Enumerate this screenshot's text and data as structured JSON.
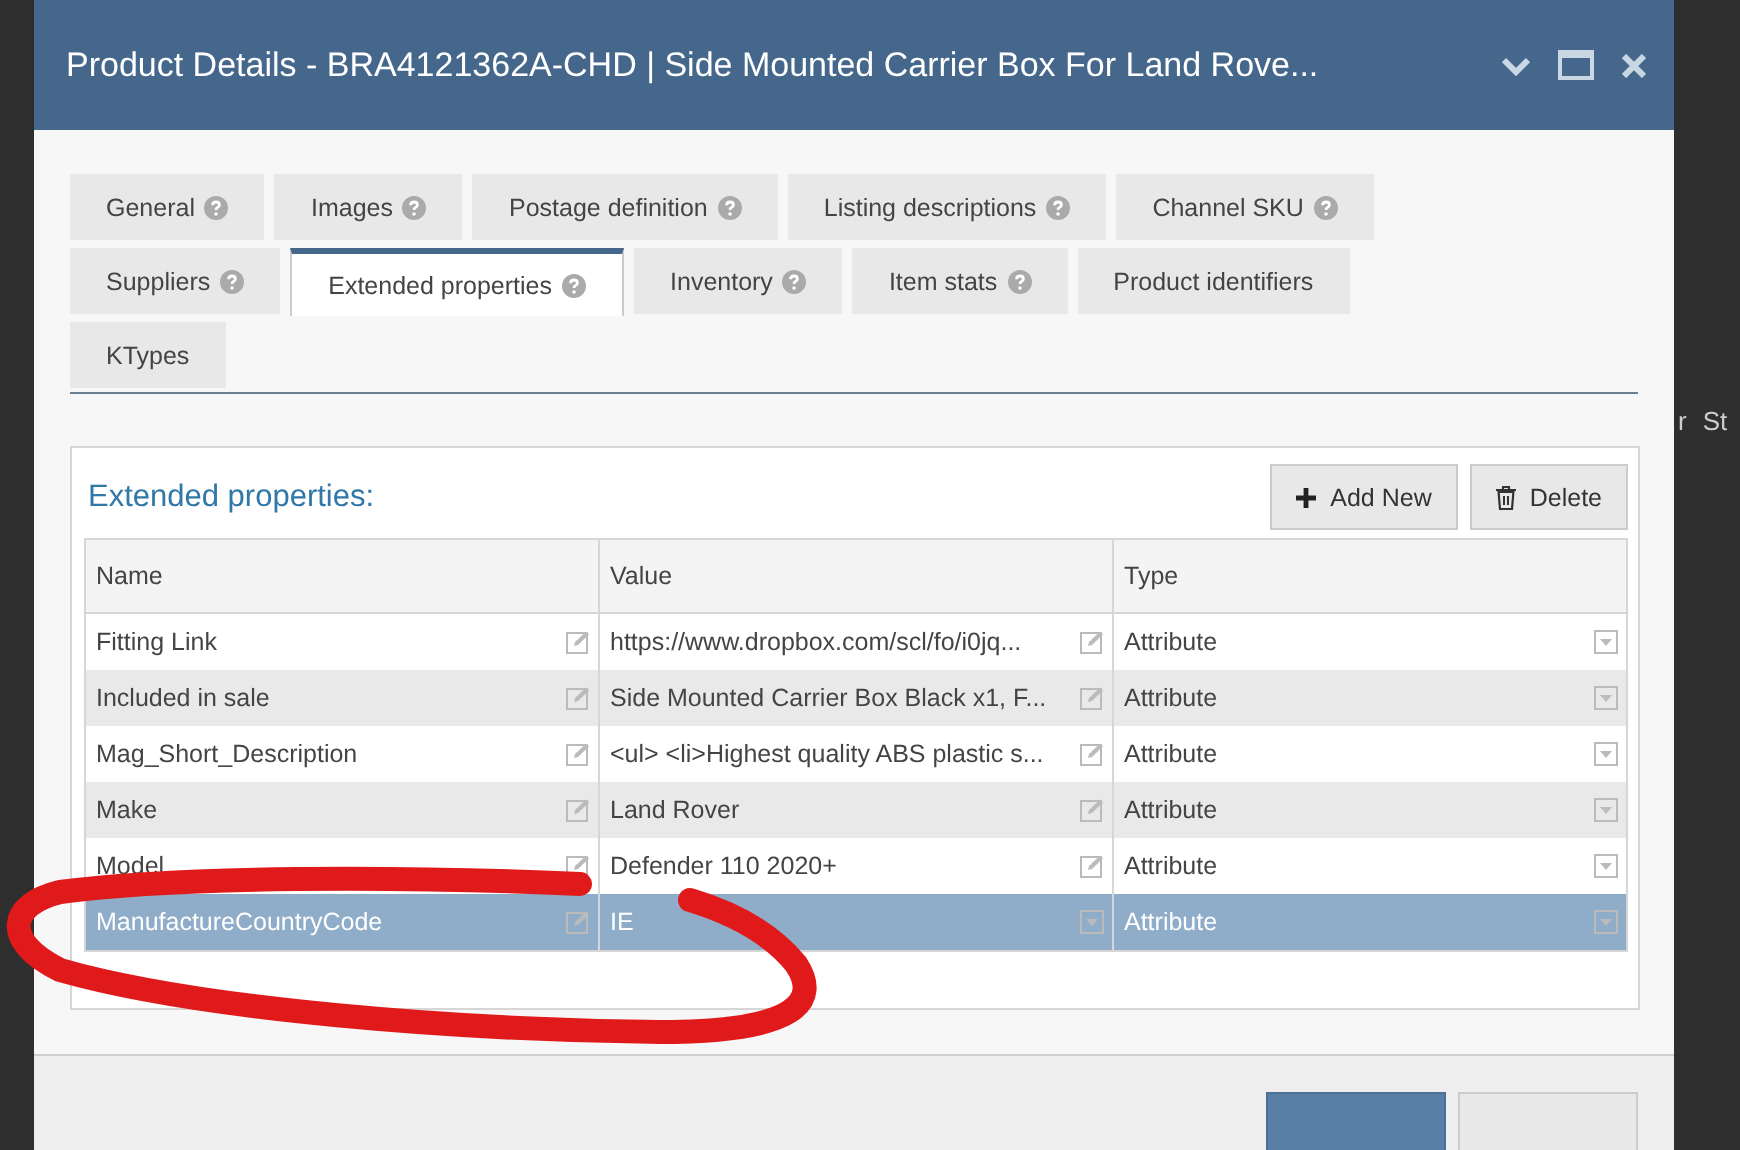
{
  "background_table": {
    "columns": [
      "r",
      "St"
    ]
  },
  "window": {
    "title": "Product Details - BRA4121362A-CHD | Side Mounted Carrier Box For Land Rove..."
  },
  "tab_rows": [
    [
      {
        "label": "General",
        "help": true,
        "selected": false
      },
      {
        "label": "Images",
        "help": true,
        "selected": false
      },
      {
        "label": "Postage definition",
        "help": true,
        "selected": false
      },
      {
        "label": "Listing descriptions",
        "help": true,
        "selected": false
      },
      {
        "label": "Channel SKU",
        "help": true,
        "selected": false
      }
    ],
    [
      {
        "label": "Suppliers",
        "help": true,
        "selected": false
      },
      {
        "label": "Extended properties",
        "help": true,
        "selected": true
      },
      {
        "label": "Inventory",
        "help": true,
        "selected": false
      },
      {
        "label": "Item stats",
        "help": true,
        "selected": false
      },
      {
        "label": "Product identifiers",
        "help": false,
        "selected": false
      }
    ],
    [
      {
        "label": "KTypes",
        "help": false,
        "selected": false
      }
    ]
  ],
  "panel": {
    "title": "Extended properties:",
    "buttons": [
      {
        "label": "Add New",
        "kind": "add"
      },
      {
        "label": "Delete",
        "kind": "delete"
      }
    ],
    "table": {
      "columns": [
        "Name",
        "Value",
        "Type"
      ],
      "rows": [
        {
          "name": "Fitting Link",
          "value": "https://www.dropbox.com/scl/fo/i0jq...",
          "type": "Attribute",
          "selected": false
        },
        {
          "name": "Included in sale",
          "value": "Side Mounted Carrier Box Black x1, F...",
          "type": "Attribute",
          "selected": false
        },
        {
          "name": "Mag_Short_Description",
          "value": "<ul> <li>Highest quality ABS plastic s...",
          "type": "Attribute",
          "selected": false
        },
        {
          "name": "Make",
          "value": "Land Rover",
          "type": "Attribute",
          "selected": false
        },
        {
          "name": "Model",
          "value": "Defender 110 2020+",
          "type": "Attribute",
          "selected": false
        },
        {
          "name": "ManufactureCountryCode",
          "value": "IE",
          "type": "Attribute",
          "selected": true
        }
      ]
    }
  },
  "footer": {
    "buttons": [
      {
        "kind": "primary"
      },
      {
        "kind": "secondary"
      }
    ]
  }
}
